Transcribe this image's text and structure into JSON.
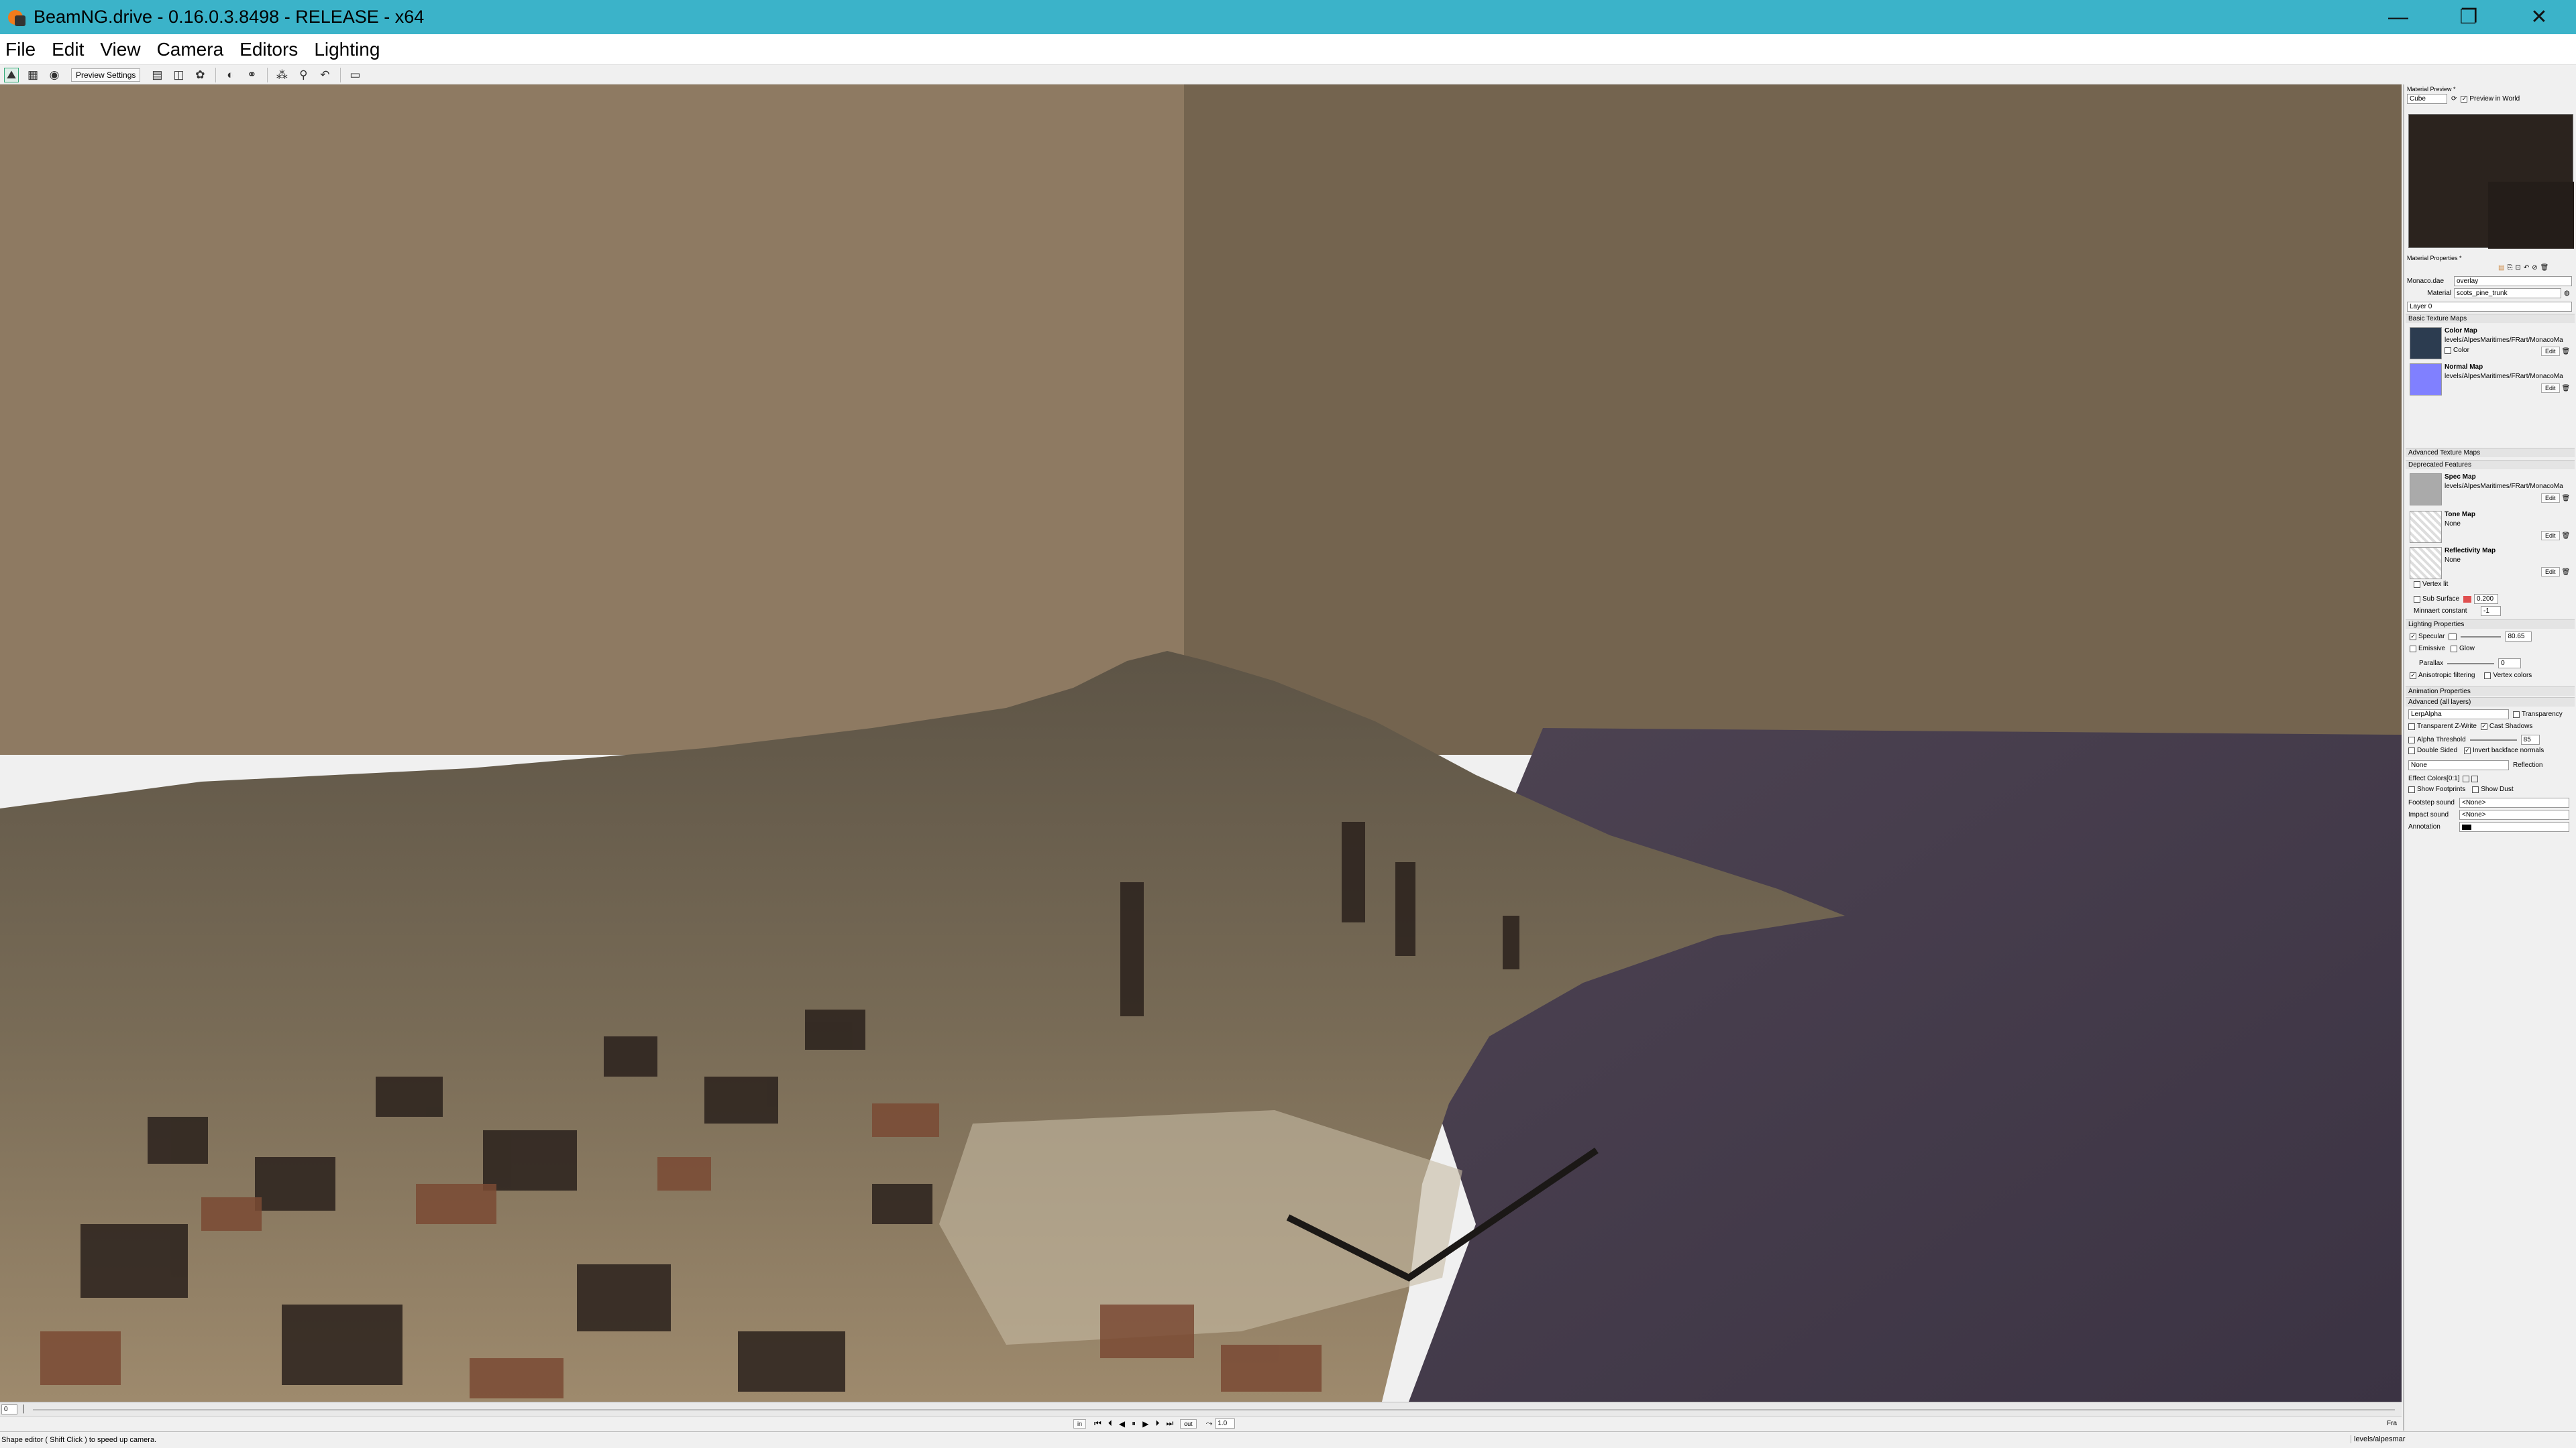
{
  "window": {
    "title": "BeamNG.drive - 0.16.0.3.8498 - RELEASE - x64",
    "minimize_glyph": "—",
    "maximize_glyph": "❐",
    "close_glyph": "✕"
  },
  "menu": [
    "File",
    "Edit",
    "View",
    "Camera",
    "Editors",
    "Lighting"
  ],
  "toolbar": {
    "preview_settings": "Preview Settings"
  },
  "material_preview": {
    "title": "Material Preview *",
    "shape": "Cube",
    "preview_in_world": "Preview in World"
  },
  "material_properties": {
    "title": "Material Properties *",
    "dae_label": "Monaco.dae",
    "dae_value": "overlay",
    "material_label": "Material",
    "material_value": "scots_pine_trunk",
    "layer": "Layer 0",
    "sections": {
      "basic_texture_maps": "Basic Texture Maps",
      "advanced_texture_maps": "Advanced Texture Maps",
      "deprecated_features": "Deprecated Features",
      "lighting_properties": "Lighting Properties",
      "animation_properties": "Animation Properties",
      "advanced_all_layers": "Advanced (all layers)"
    },
    "color_map": {
      "title": "Color Map",
      "path": "levels/AlpesMaritimes/FRart/MonacoMa",
      "color_label": "Color",
      "edit": "Edit"
    },
    "normal_map": {
      "title": "Normal Map",
      "path": "levels/AlpesMaritimes/FRart/MonacoMa",
      "edit": "Edit"
    },
    "spec_map": {
      "title": "Spec Map",
      "path": "levels/AlpesMaritimes/FRart/MonacoMa",
      "edit": "Edit"
    },
    "tone_map": {
      "title": "Tone Map",
      "path": "None",
      "edit": "Edit"
    },
    "reflectivity_map": {
      "title": "Reflectivity Map",
      "path": "None",
      "edit": "Edit"
    },
    "vertex_lit": "Vertex lit",
    "sub_surface": "Sub Surface",
    "sub_surface_value": "0.200",
    "minnaert_label": "Minnaert constant",
    "minnaert_value": "-1",
    "specular_label": "Specular",
    "specular_value": "80.65",
    "emissive_label": "Emissive",
    "glow_label": "Glow",
    "parallax_label": "Parallax",
    "parallax_value": "0",
    "anisotropic_label": "Anisotropic filtering",
    "vertex_colors_label": "Vertex colors",
    "blend_mode": "LerpAlpha",
    "transparency_label": "Transparency",
    "transparent_zwrite_label": "Transparent Z-Write",
    "cast_shadows_label": "Cast Shadows",
    "alpha_threshold_label": "Alpha Threshold",
    "alpha_threshold_value": "85",
    "double_sided_label": "Double Sided",
    "invert_backface_label": "Invert backface normals",
    "reflection_mode": "None",
    "reflection_label": "Reflection",
    "effect_colors_label": "Effect Colors[0:1]",
    "show_footprints_label": "Show Footprints",
    "show_dust_label": "Show Dust",
    "footstep_sound_label": "Footstep sound",
    "footstep_sound_value": "<None>",
    "impact_sound_label": "Impact sound",
    "impact_sound_value": "<None>",
    "annotation_label": "Annotation"
  },
  "timeline": {
    "value": "0",
    "in_label": "in",
    "out_label": "out",
    "speed": "1.0",
    "frame_label": "Fra"
  },
  "status": {
    "message": "Shape editor ( Shift Click ) to speed up camera.",
    "right": "levels/alpesmar"
  }
}
